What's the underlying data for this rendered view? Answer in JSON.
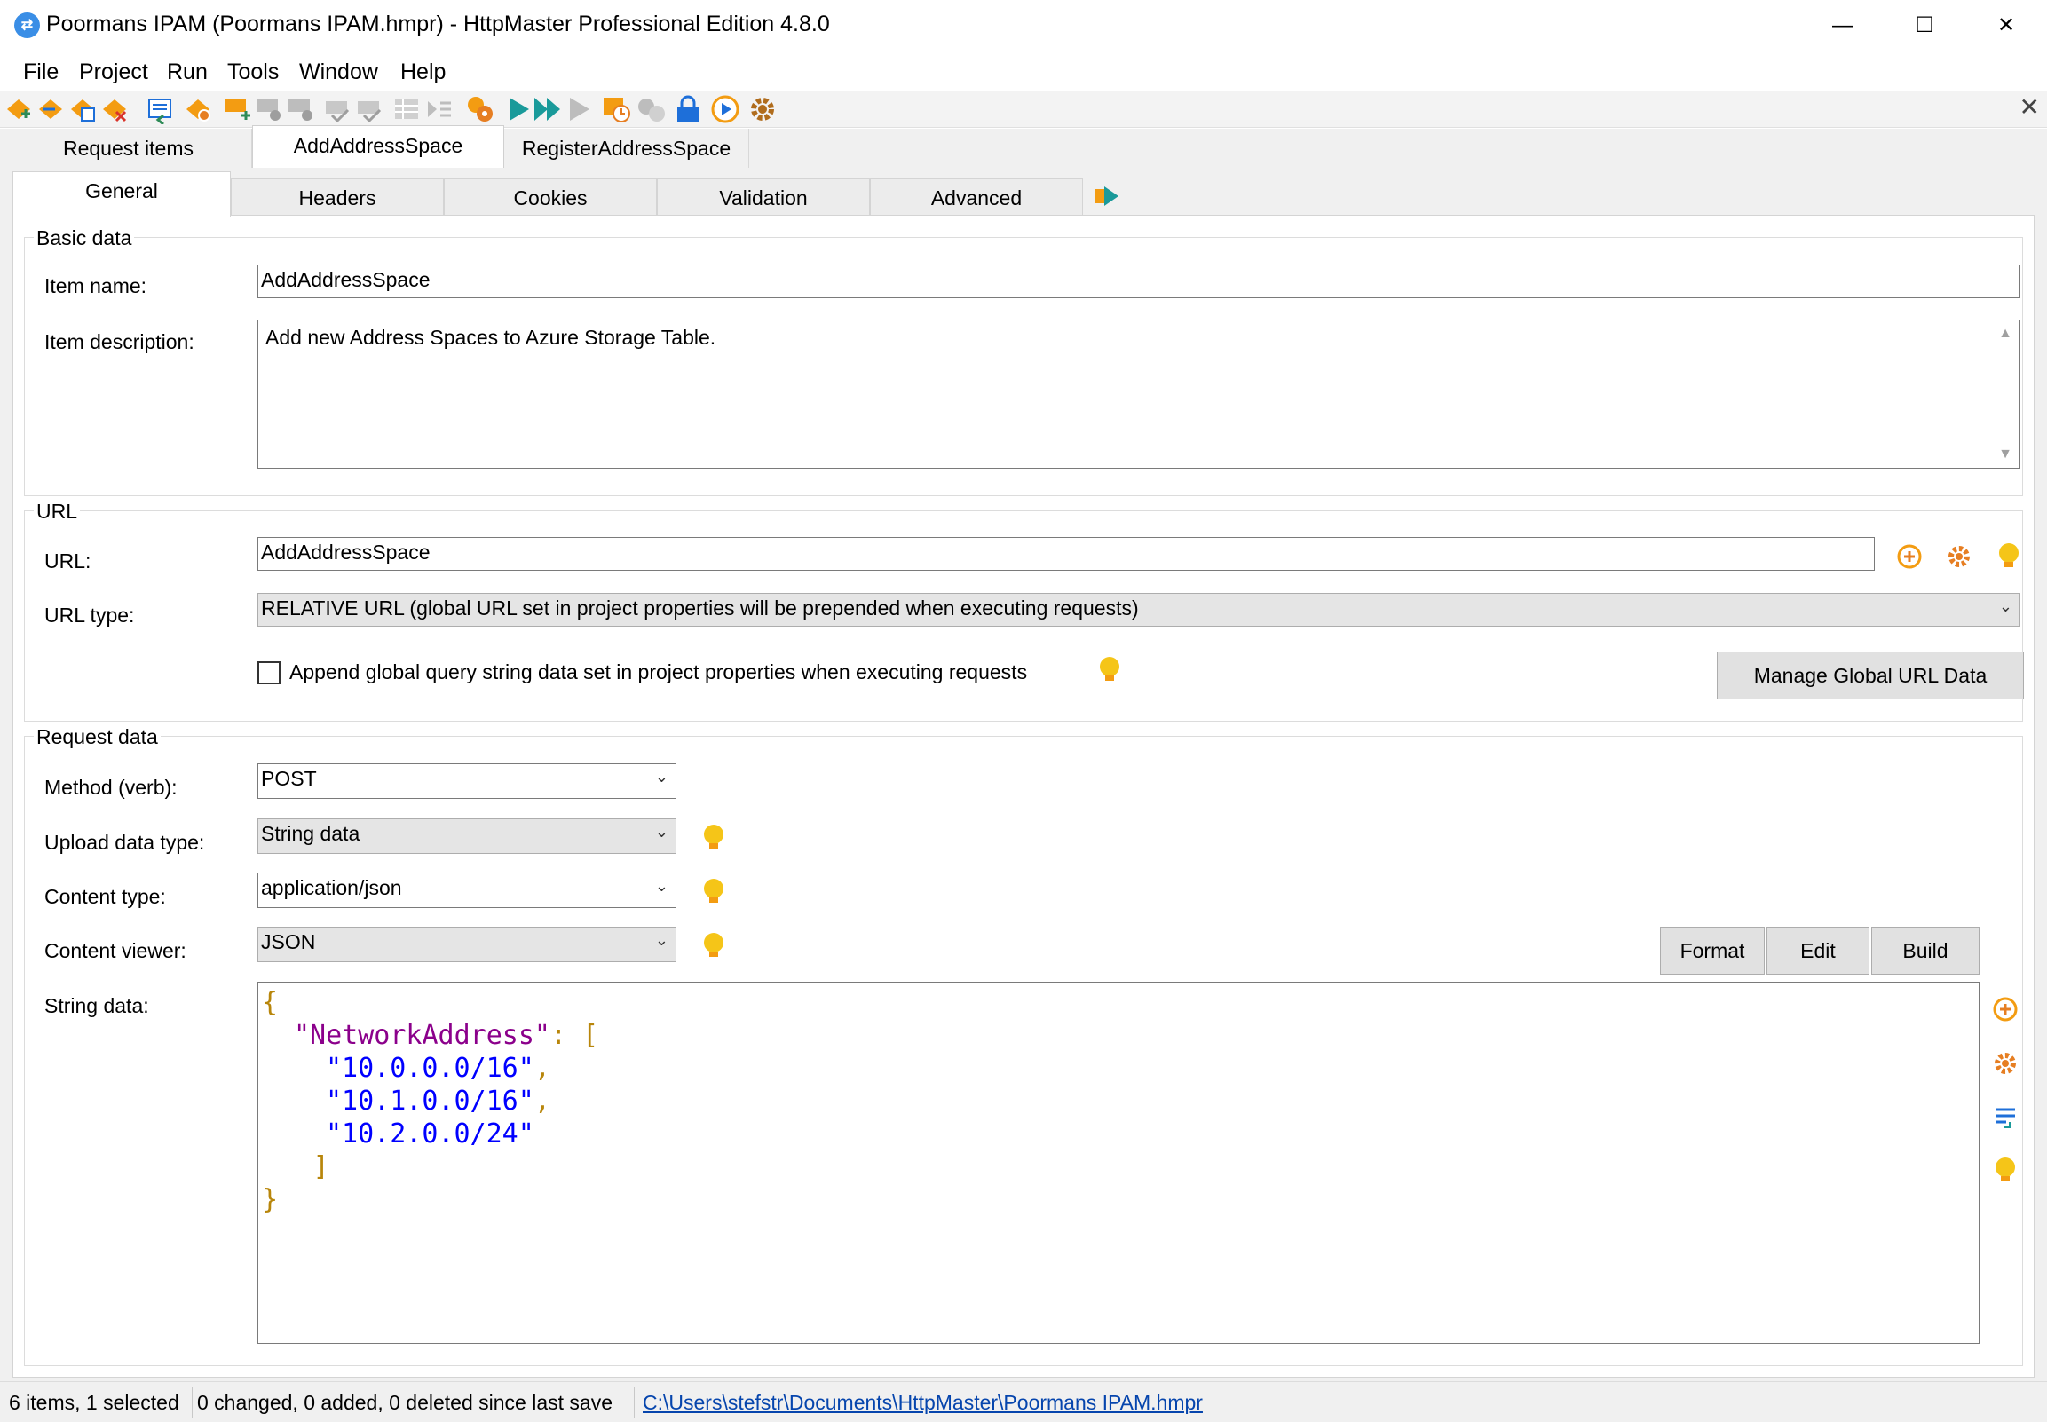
{
  "window": {
    "title": "Poormans IPAM (Poormans IPAM.hmpr) - HttpMaster Professional Edition 4.8.0",
    "minimize": "—",
    "maximize": "☐",
    "close": "✕"
  },
  "menu": [
    "File",
    "Project",
    "Run",
    "Tools",
    "Window",
    "Help"
  ],
  "toolbar": {
    "close": "✕"
  },
  "doc_tabs": [
    "Request items",
    "AddAddressSpace",
    "RegisterAddressSpace"
  ],
  "sub_tabs": [
    "General",
    "Headers",
    "Cookies",
    "Validation",
    "Advanced"
  ],
  "basic_data": {
    "title": "Basic data",
    "item_name_label": "Item name:",
    "item_name": "AddAddressSpace",
    "item_desc_label": "Item description:",
    "item_desc": "Add new Address Spaces to Azure Storage Table."
  },
  "url": {
    "title": "URL",
    "url_label": "URL:",
    "url_value": "AddAddressSpace",
    "type_label": "URL type:",
    "type_value": "RELATIVE URL (global URL set in project properties will be prepended when executing requests)",
    "append_label": "Append global query string data set in project properties when executing requests",
    "manage_button": "Manage Global URL Data"
  },
  "request_data": {
    "title": "Request data",
    "method_label": "Method (verb):",
    "method_value": "POST",
    "upload_label": "Upload data type:",
    "upload_value": "String data",
    "content_type_label": "Content type:",
    "content_type_value": "application/json",
    "viewer_label": "Content viewer:",
    "viewer_value": "JSON",
    "string_label": "String data:",
    "format_button": "Format",
    "edit_button": "Edit",
    "build_button": "Build",
    "json_lines": [
      {
        "indent": 0,
        "parts": [
          {
            "c": "brace",
            "t": "{"
          }
        ]
      },
      {
        "indent": 1,
        "parts": [
          {
            "c": "key",
            "t": "\"NetworkAddress\""
          },
          {
            "c": "punct",
            "t": ": ["
          }
        ]
      },
      {
        "indent": 2,
        "parts": [
          {
            "c": "str",
            "t": "\"10.0.0.0/16\""
          },
          {
            "c": "punct",
            "t": ","
          }
        ]
      },
      {
        "indent": 2,
        "parts": [
          {
            "c": "str",
            "t": "\"10.1.0.0/16\""
          },
          {
            "c": "punct",
            "t": ","
          }
        ]
      },
      {
        "indent": 2,
        "parts": [
          {
            "c": "str",
            "t": "\"10.2.0.0/24\""
          }
        ]
      },
      {
        "indent": 1.6,
        "parts": [
          {
            "c": "punct",
            "t": "]"
          }
        ]
      },
      {
        "indent": 0,
        "parts": [
          {
            "c": "brace",
            "t": "}"
          }
        ]
      }
    ]
  },
  "status": {
    "items": "6 items, 1 selected",
    "changes": "0 changed, 0 added, 0 deleted since last save",
    "path": "C:\\Users\\stefstr\\Documents\\HttpMaster\\Poormans IPAM.hmpr"
  },
  "colors": {
    "accent_orange": "#f39c12",
    "bulb_yellow": "#f5c518",
    "play_teal": "#1a9a9a",
    "link_blue": "#0645ad"
  }
}
